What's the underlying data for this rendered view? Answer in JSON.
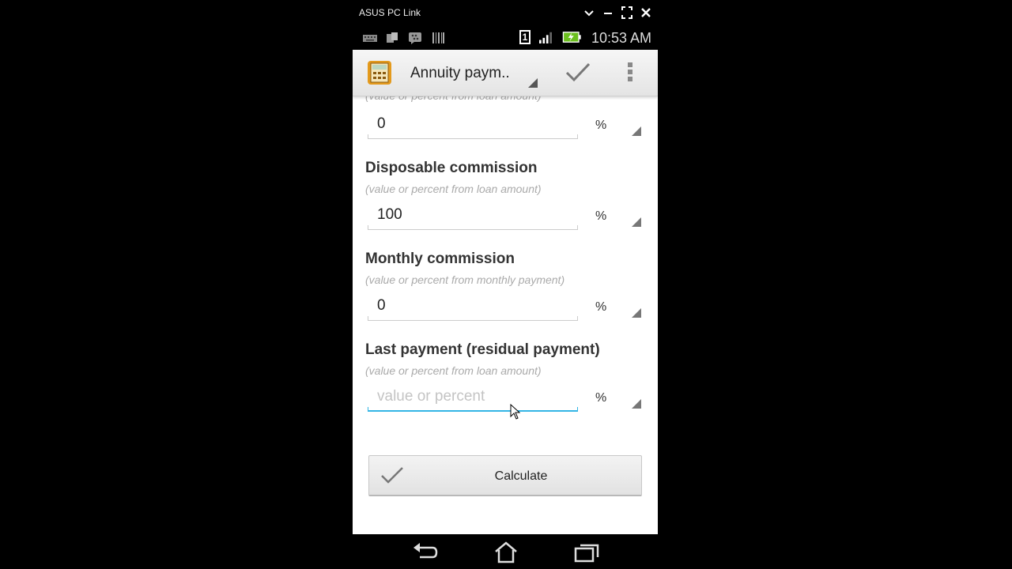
{
  "window": {
    "title": "ASUS PC Link",
    "controls": [
      "minimize-chevron",
      "minimize",
      "fullscreen",
      "close"
    ]
  },
  "status_bar": {
    "time": "10:53 AM",
    "sim": "1",
    "icons": [
      "keyboard-icon",
      "screen-icon",
      "bbm-icon",
      "barcode-icon",
      "sim-icon",
      "signal-icon",
      "battery-charging-icon"
    ]
  },
  "action_bar": {
    "title": "Annuity paym..",
    "icons": [
      "calculator-app-icon",
      "check-icon",
      "overflow-menu-icon"
    ]
  },
  "form": {
    "top_hint": "(value or percent from loan amount)",
    "top_value": "0",
    "top_unit": "%",
    "fields": [
      {
        "label": "Disposable commission",
        "hint": "(value or percent from loan amount)",
        "value": "100",
        "unit": "%"
      },
      {
        "label": "Monthly commission",
        "hint": "(value or percent from monthly payment)",
        "value": "0",
        "unit": "%"
      },
      {
        "label": "Last payment (residual payment)",
        "hint": "(value or percent from loan amount)",
        "value": "",
        "placeholder": "value or percent",
        "unit": "%"
      }
    ],
    "calculate_label": "Calculate"
  },
  "colors": {
    "focus": "#33b5e5"
  }
}
